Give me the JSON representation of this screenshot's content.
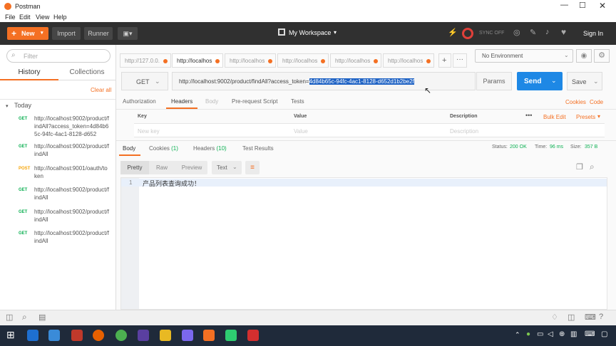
{
  "window": {
    "title": "Postman"
  },
  "menu": [
    "File",
    "Edit",
    "View",
    "Help"
  ],
  "toolbar": {
    "new_label": "New",
    "import_label": "Import",
    "runner_label": "Runner",
    "workspace_label": "My Workspace",
    "sync_label": "SYNC OFF",
    "signin_label": "Sign In"
  },
  "sidebar": {
    "search_placeholder": "Filter",
    "tab_history": "History",
    "tab_collections": "Collections",
    "clear_all": "Clear all",
    "group_label": "Today",
    "items": [
      {
        "method": "GET",
        "url": "http://localhost:9002/product/findAll?access_token=4d84b65c-94fc-4ac1-8128-d652"
      },
      {
        "method": "GET",
        "url": "http://localhost:9002/product/findAll"
      },
      {
        "method": "POST",
        "url": "http://localhost:9001/oauth/token"
      },
      {
        "method": "GET",
        "url": "http://localhost:9002/product/findAll"
      },
      {
        "method": "GET",
        "url": "http://localhost:9002/product/findAll"
      },
      {
        "method": "GET",
        "url": "http://localhost:9002/product/findAll"
      }
    ]
  },
  "tabs": [
    "http://127.0.0.",
    "http://localhos",
    "http://localhos",
    "http://localhos",
    "http://localhos",
    "http://localhos"
  ],
  "environment": "No Environment",
  "request": {
    "method": "GET",
    "url_prefix": "http://localhost:9002/product/findAll?access_token=",
    "url_token": "4d84b65c-94fc-4ac1-8128-d652d1b2be2f",
    "params_label": "Params",
    "send_label": "Send",
    "save_label": "Save"
  },
  "req_tabs": [
    "Authorization",
    "Headers",
    "Body",
    "Pre-request Script",
    "Tests"
  ],
  "req_links": {
    "cookies": "Cookies",
    "code": "Code"
  },
  "headers_table": {
    "col_key": "Key",
    "col_value": "Value",
    "col_desc": "Description",
    "bulk_edit": "Bulk Edit",
    "presets": "Presets",
    "key_placeholder": "New key",
    "value_placeholder": "Value",
    "desc_placeholder": "Description"
  },
  "resp_tabs": {
    "body": "Body",
    "cookies": "Cookies",
    "cookies_count": "(1)",
    "headers": "Headers",
    "headers_count": "(10)",
    "tests": "Test Results"
  },
  "resp_status": {
    "status_label": "Status:",
    "status_value": "200 OK",
    "time_label": "Time:",
    "time_value": "96 ms",
    "size_label": "Size:",
    "size_value": "357 B"
  },
  "resp_view": {
    "pretty": "Pretty",
    "raw": "Raw",
    "preview": "Preview",
    "format": "Text"
  },
  "response_body": {
    "line_no": "1",
    "text": "产品列表查询成功！"
  },
  "colors": {
    "accent": "#f47023",
    "send": "#1e88e5",
    "get": "#0cb052",
    "post": "#f6a60b"
  }
}
